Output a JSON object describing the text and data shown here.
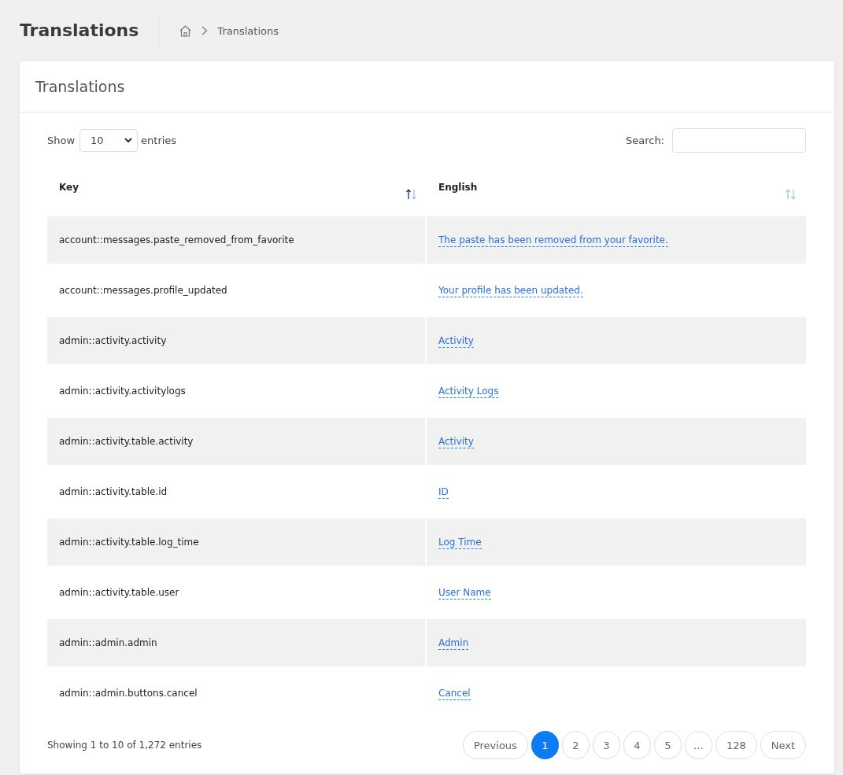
{
  "page_title": "Translations",
  "breadcrumb": {
    "current": "Translations"
  },
  "card": {
    "title": "Translations"
  },
  "length_control": {
    "before": "Show",
    "value": "10",
    "after": "entries"
  },
  "search": {
    "label": "Search:"
  },
  "table": {
    "columns": [
      {
        "label": "Key",
        "sorted": true
      },
      {
        "label": "English",
        "sorted": false
      }
    ],
    "rows": [
      {
        "key": "account::messages.paste_removed_from_favorite",
        "english": "The paste has been removed from your favorite."
      },
      {
        "key": "account::messages.profile_updated",
        "english": "Your profile has been updated."
      },
      {
        "key": "admin::activity.activity",
        "english": "Activity"
      },
      {
        "key": "admin::activity.activitylogs",
        "english": "Activity Logs"
      },
      {
        "key": "admin::activity.table.activity",
        "english": "Activity"
      },
      {
        "key": "admin::activity.table.id",
        "english": "ID"
      },
      {
        "key": "admin::activity.table.log_time",
        "english": "Log Time"
      },
      {
        "key": "admin::activity.table.user",
        "english": "User Name"
      },
      {
        "key": "admin::admin.admin",
        "english": "Admin"
      },
      {
        "key": "admin::admin.buttons.cancel",
        "english": "Cancel"
      }
    ]
  },
  "info": "Showing 1 to 10 of 1,272 entries",
  "pagination": [
    {
      "label": "Previous",
      "kind": "wide",
      "selected": false
    },
    {
      "label": "1",
      "kind": "page",
      "selected": true
    },
    {
      "label": "2",
      "kind": "page",
      "selected": false
    },
    {
      "label": "3",
      "kind": "page",
      "selected": false
    },
    {
      "label": "4",
      "kind": "page",
      "selected": false
    },
    {
      "label": "5",
      "kind": "page",
      "selected": false
    },
    {
      "label": "…",
      "kind": "page",
      "selected": false
    },
    {
      "label": "128",
      "kind": "wide",
      "selected": false
    },
    {
      "label": "Next",
      "kind": "wide",
      "selected": false
    }
  ]
}
